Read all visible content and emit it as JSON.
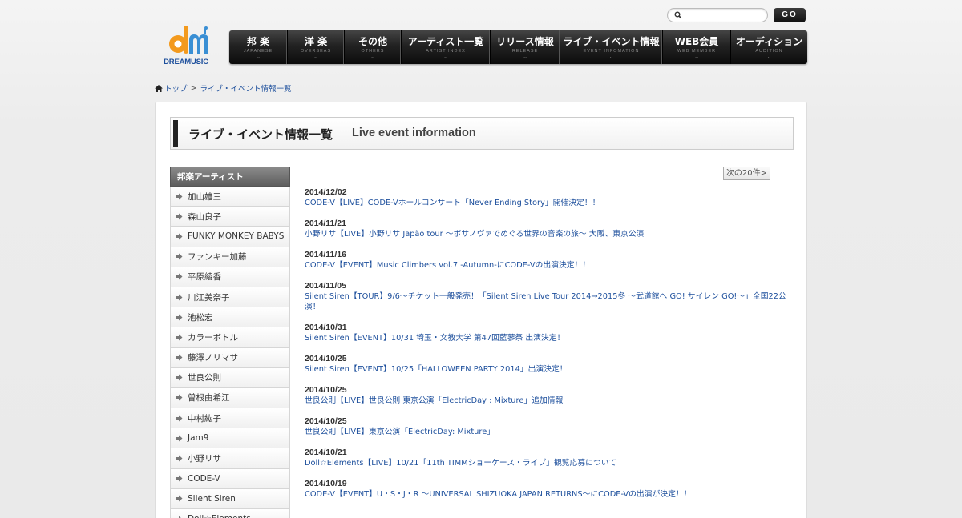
{
  "search": {
    "placeholder": "",
    "go_label": "GO"
  },
  "logo": {
    "brand": "DREAMUSIC",
    "colors": {
      "orange": "#f39a1e",
      "blue": "#3a8fd4"
    }
  },
  "nav": [
    {
      "jp": "邦 楽",
      "en": "JAPANESE"
    },
    {
      "jp": "洋 楽",
      "en": "OVERSEAS"
    },
    {
      "jp": "その他",
      "en": "OTHERS"
    },
    {
      "jp": "アーティスト一覧",
      "en": "ARTIST INDEX"
    },
    {
      "jp": "リリース情報",
      "en": "RELEASE"
    },
    {
      "jp": "ライブ・イベント情報",
      "en": "EVENT INFOMATION"
    },
    {
      "jp": "WEB会員",
      "en": "WEB MEMBER"
    },
    {
      "jp": "オーディション",
      "en": "AUDITION"
    }
  ],
  "breadcrumb": {
    "home": "トップ",
    "separator": ">",
    "current": "ライブ・イベント情報一覧"
  },
  "page_title": {
    "jp": "ライブ・イベント情報一覧",
    "en": "Live event information"
  },
  "sidebar": {
    "heading": "邦楽アーティスト",
    "artists": [
      "加山雄三",
      "森山良子",
      "FUNKY MONKEY BABYS",
      "ファンキー加藤",
      "平原綾香",
      "川江美奈子",
      "池松宏",
      "カラーボトル",
      "藤澤ノリマサ",
      "世良公則",
      "曽根由希江",
      "中村紘子",
      "Jam9",
      "小野リサ",
      "CODE-V",
      "Silent Siren",
      "Doll☆Elements"
    ]
  },
  "next_button": "次の20件>",
  "news": [
    {
      "date": "2014/12/02",
      "text": "CODE-V【LIVE】CODE-Vホールコンサート「Never Ending Story」開催決定！！"
    },
    {
      "date": "2014/11/21",
      "text": "小野リサ【LIVE】小野リサ Japão tour 〜ボサノヴァでめぐる世界の音楽の旅〜 大阪、東京公演"
    },
    {
      "date": "2014/11/16",
      "text": "CODE-V【EVENT】Music Climbers vol.7 -Autumn-にCODE-Vの出演決定！！"
    },
    {
      "date": "2014/11/05",
      "text": "Silent Siren【TOUR】9/6〜チケット一般発売！「Silent Siren Live Tour 2014→2015冬 〜武道館へ GO! サイレン GO!〜」全国22公演！"
    },
    {
      "date": "2014/10/31",
      "text": "Silent Siren【EVENT】10/31 埼玉・文教大学 第47回藍蓼祭 出演決定！"
    },
    {
      "date": "2014/10/25",
      "text": "Silent Siren【EVENT】10/25「HALLOWEEN PARTY 2014」出演決定！"
    },
    {
      "date": "2014/10/25",
      "text": "世良公則【LIVE】世良公則 東京公演「ElectricDay : Mixture」追加情報"
    },
    {
      "date": "2014/10/25",
      "text": "世良公則【LIVE】東京公演「ElectricDay: Mixture」"
    },
    {
      "date": "2014/10/21",
      "text": "Doll☆Elements【LIVE】10/21「11th TIMMショーケース・ライブ」観覧応募について"
    },
    {
      "date": "2014/10/19",
      "text": "CODE-V【EVENT】U・S・J・R 〜UNIVERSAL SHIZUOKA JAPAN RETURNS〜にCODE-Vの出演が決定！！"
    }
  ]
}
